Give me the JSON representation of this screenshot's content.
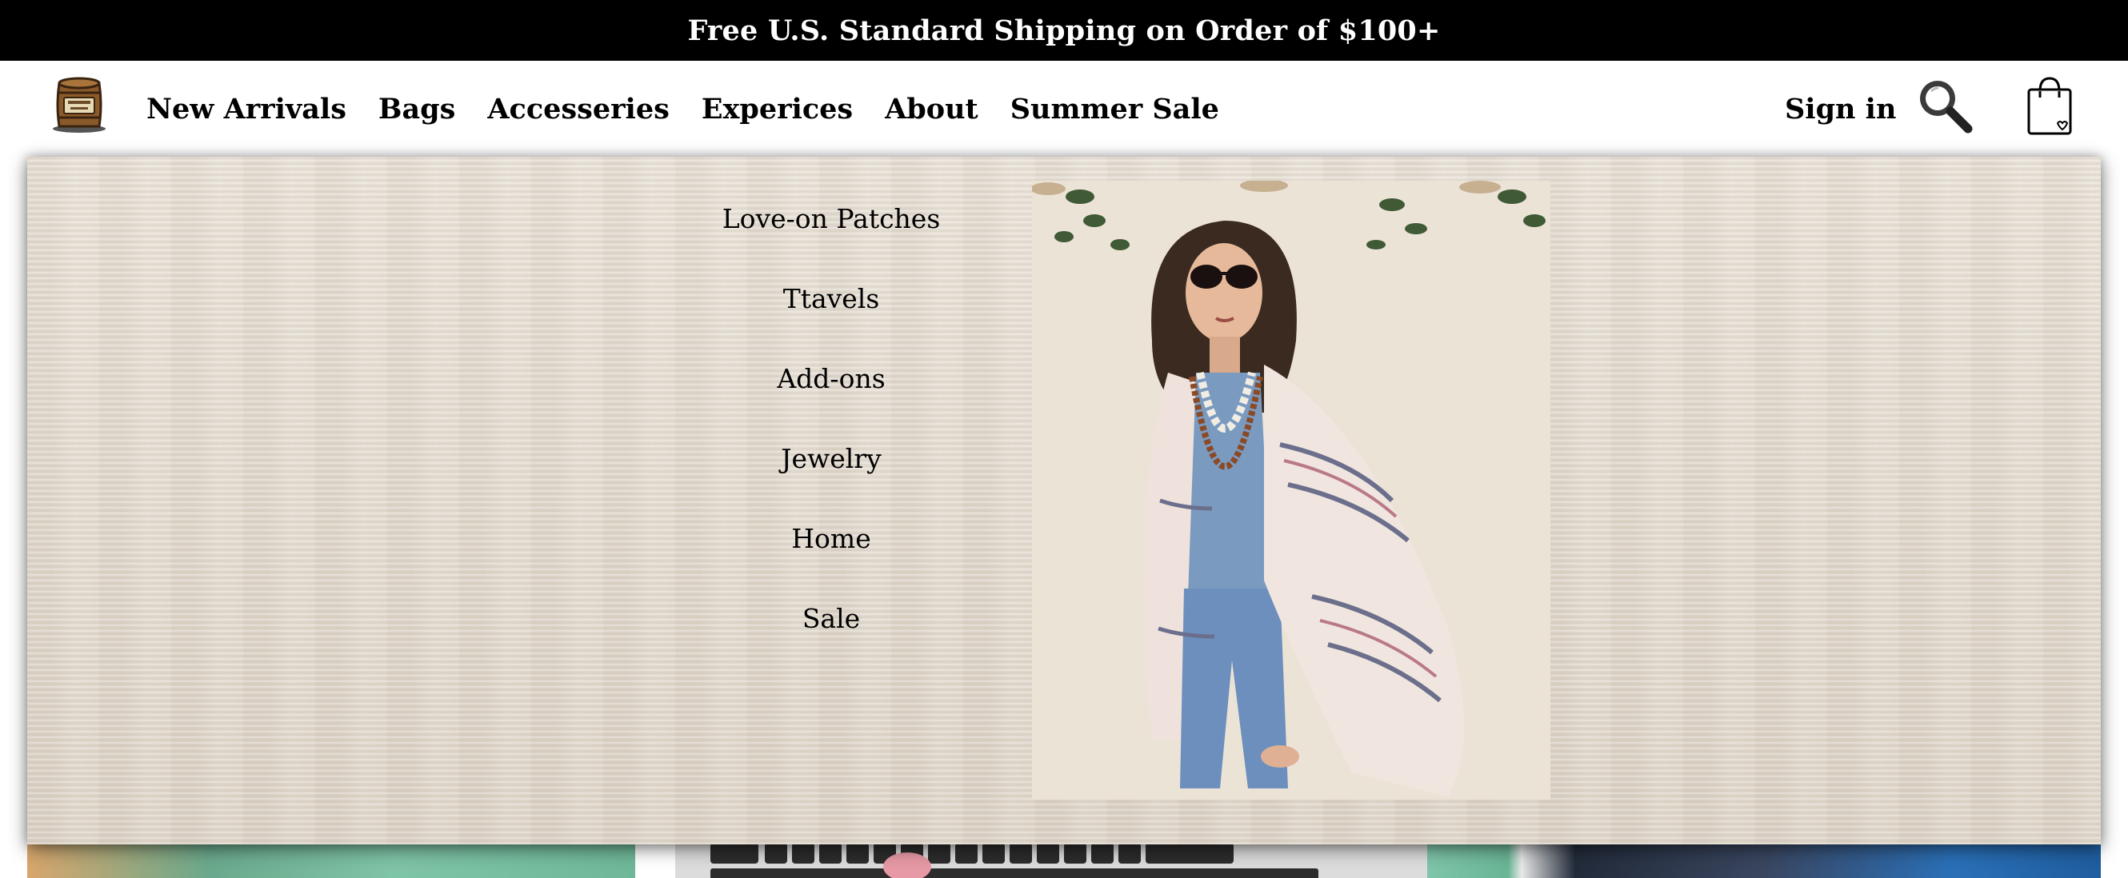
{
  "announcement": {
    "text": "Free U.S. Standard Shipping on Order of $100+"
  },
  "nav": {
    "items": [
      {
        "label": "New Arrivals"
      },
      {
        "label": "Bags"
      },
      {
        "label": "Accesseries"
      },
      {
        "label": "Experices"
      },
      {
        "label": "About"
      },
      {
        "label": "Summer Sale"
      }
    ]
  },
  "header": {
    "sign_in": "Sign in",
    "logo_icon": "barrel-logo-icon",
    "search_icon": "search-icon",
    "bag_icon": "shopping-bag-icon"
  },
  "dropdown": {
    "items": [
      {
        "label": "Love-on Patches"
      },
      {
        "label": "Ttavels"
      },
      {
        "label": "Add-ons"
      },
      {
        "label": "Jewelry"
      },
      {
        "label": "Home"
      },
      {
        "label": "Sale"
      }
    ],
    "promo_image": "woman-in-striped-shawl-photo"
  },
  "colors": {
    "announcement_bg": "#000000",
    "dropdown_bg": "#e4dcd1"
  }
}
